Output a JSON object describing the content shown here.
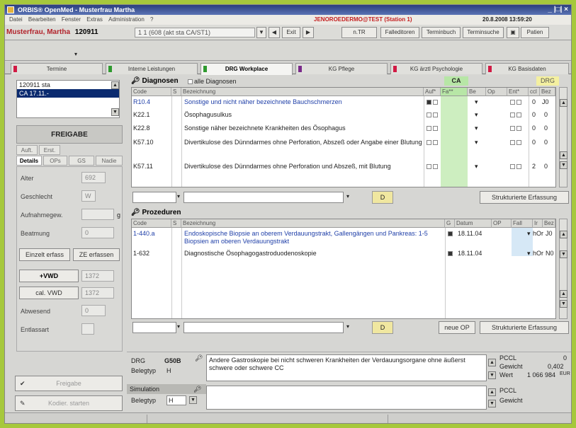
{
  "window": {
    "title": "ORBIS® OpenMed - Musterfrau Martha",
    "controls": "_ |□| ×"
  },
  "menu": {
    "items": [
      "Datei",
      "Bearbeiten",
      "Fenster",
      "Extras",
      "Administration",
      "?"
    ],
    "user": "JENOROEDERMO@TEST (Station 1)",
    "datetime": "20.8.2008 13:59:20"
  },
  "patient": {
    "name": "Musterfrau, Martha",
    "id": "120911",
    "case_label": "1 1 (608 (akt sta CA/ST1)"
  },
  "toolbar": {
    "buttons": [
      "Exit",
      "n.TR",
      "Falleditoren",
      "Terminbuch",
      "Terminsuche",
      "Patien"
    ]
  },
  "tabs": [
    {
      "label": "Termine",
      "color": "#d11a44"
    },
    {
      "label": "Interne Leistungen",
      "color": "#2f9a2f"
    },
    {
      "label": "DRG Workplace",
      "color": "#2f9a2f"
    },
    {
      "label": "KG Pflege",
      "color": "#7a2a8a"
    },
    {
      "label": "KG ärztl Psychologie",
      "color": "#d11a44"
    },
    {
      "label": "KG Basisdaten",
      "color": "#d11a44"
    }
  ],
  "left": {
    "cases": [
      "120911 sta",
      "CA 17.11.-"
    ],
    "freigabe": "FREIGABE",
    "top_tabs": [
      "Auft.",
      "Erst."
    ],
    "tabs": [
      "Details",
      "OPs",
      "GS",
      "Nadie"
    ],
    "fields": [
      {
        "label": "Alter",
        "value": "692"
      },
      {
        "label": "Geschlecht",
        "value": "W"
      },
      {
        "label": "Aufnahmegew.",
        "value": "",
        "unit": "g"
      },
      {
        "label": "Beatmung",
        "value": "0"
      }
    ],
    "btn_erfass": "Einzelt erfass",
    "btn_ze": "ZE erfassen",
    "vwd_plus": "+VWD",
    "vwd_plus_value": "1372",
    "vwd_minus": "cal. VWD",
    "vwd_minus_value": "1372",
    "fields2": [
      {
        "label": "Abwesend",
        "value": "0"
      },
      {
        "label": "Entlassart",
        "value": ""
      }
    ],
    "btn_bottom1": "Freigabe",
    "btn_bottom2": "Kodier. starten"
  },
  "diagnosen": {
    "title": "Diagnosen",
    "alle_label": "alle Diagnosen",
    "group_ca": "CA",
    "group_drg": "DRG",
    "columns": [
      "Code",
      "S",
      "Bezeichnung",
      "Auf*",
      "Fa**",
      "Be",
      "Op",
      "Ent*",
      "ccl",
      "Bez"
    ],
    "rows": [
      {
        "code": "R10.4",
        "text": "Sonstige und nicht näher bezeichnete Bauchschmerzen",
        "ccl": "0",
        "bez": "J0",
        "blue": true
      },
      {
        "code": "K22.1",
        "text": "Ösophagusulkus",
        "ccl": "0",
        "bez": "0",
        "blue": false
      },
      {
        "code": "K22.8",
        "text": "Sonstige näher bezeichnete Krankheiten des Ösophagus",
        "ccl": "0",
        "bez": "0",
        "blue": false
      },
      {
        "code": "K57.10",
        "text": "Divertikulose des Dünndarmes ohne Perforation, Abszeß oder Angabe einer Blutung",
        "ccl": "0",
        "bez": "0",
        "blue": false
      },
      {
        "code": "K57.11",
        "text": "Divertikulose des Dünndarmes ohne Perforation und Abszeß, mit Blutung",
        "ccl": "2",
        "bez": "0",
        "blue": false
      }
    ],
    "btn_d": "D",
    "btn_struct": "Strukturierte Erfassung"
  },
  "prozeduren": {
    "title": "Prozeduren",
    "columns": [
      "Code",
      "S",
      "Bezeichnung",
      "G",
      "Datum",
      "OP",
      "Fall",
      "Ir",
      "Bez"
    ],
    "rows": [
      {
        "code": "1-440.a",
        "text": "Endoskopische Biopsie an oberem Verdauungstrakt, Gallengängen und Pankreas: 1-5 Biopsien am oberen Verdauungstrakt",
        "date": "18.11.04",
        "ir": "hOr",
        "bez": "J0",
        "blue": true
      },
      {
        "code": "1-632",
        "text": "Diagnostische Ösophagogastroduodenoskopie",
        "date": "18.11.04",
        "ir": "hOr",
        "bez": "N0",
        "blue": false
      }
    ],
    "btn_d": "D",
    "btn_neue_op": "neue OP",
    "btn_struct": "Strukturierte Erfassung"
  },
  "drg": {
    "label": "DRG",
    "code": "G50B",
    "beleg_label": "Belegtyp",
    "beleg": "H",
    "text": "Andere Gastroskopie bei nicht schweren Krankheiten der Verdauungsorgane ohne äußerst schwere oder schwere CC",
    "pccl_label": "PCCL",
    "pccl": "0",
    "gewicht_label": "Gewicht",
    "gewicht": "0,402",
    "wert_label": "Wert",
    "wert": "1 066 984",
    "unit": "EUR"
  },
  "simulation": {
    "label": "Simulation",
    "beleg_label": "Belegtyp",
    "beleg": "H",
    "pccl_label": "PCCL",
    "gewicht_label": "Gewicht"
  }
}
